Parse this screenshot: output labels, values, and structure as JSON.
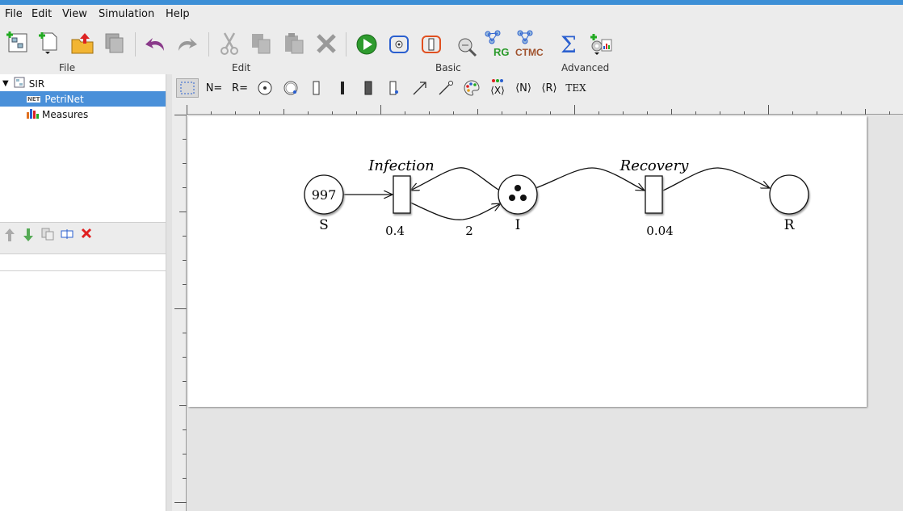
{
  "menu": {
    "file": "File",
    "edit": "Edit",
    "view": "View",
    "simulation": "Simulation",
    "help": "Help"
  },
  "toolbar": {
    "groups": [
      "File",
      "Edit",
      "Basic",
      "Advanced"
    ],
    "rg_label": "RG",
    "ctmc_label": "CTMC",
    "sigma_label": "Σ"
  },
  "tree": {
    "root": "SIR",
    "net_badge": "NET",
    "petrinet": "PetriNet",
    "measures": "Measures"
  },
  "editor_tools": {
    "n_eq": "N=",
    "r_eq": "R=",
    "x_var": "⟨X⟩",
    "n_angle": "⟨N⟩",
    "r_angle": "⟨R⟩",
    "tex": "TEX"
  },
  "net": {
    "places": [
      {
        "name": "S",
        "tokens": "997"
      },
      {
        "name": "I",
        "tokens": ""
      },
      {
        "name": "R",
        "tokens": ""
      }
    ],
    "transitions": [
      {
        "name": "Infection",
        "rate": "0.4"
      },
      {
        "name": "Recovery",
        "rate": "0.04"
      }
    ],
    "arc_weight": "2"
  },
  "colors": {
    "selection": "#4a90d9",
    "titlebar": "#3d8fd6",
    "play_green": "#2e9b2e",
    "delete_red": "#e02020"
  }
}
